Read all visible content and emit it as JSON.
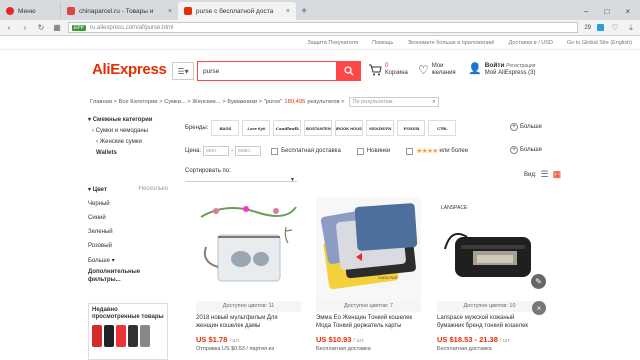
{
  "browser": {
    "menu_label": "Меню",
    "tabs": [
      {
        "label": "chinaparcel.ru - Товары и"
      },
      {
        "label": "purse с бесплатной доста"
      }
    ],
    "url_badge": "EPP",
    "url": "ru.aliexpress.com/af/purse.html",
    "zoom": "29"
  },
  "topnav": {
    "links": [
      "Защита Покупателя",
      "Помощь",
      "Экономьте больше в приложении!",
      "Доставка в",
      "/ USD",
      "Go to Global Site (English)"
    ]
  },
  "header": {
    "logo": "AliExpress",
    "search_value": "purse",
    "cart_count": "0",
    "cart_label": "Корзина",
    "wish_line1": "Мои",
    "wish_line2": "желания",
    "acct_line1": "Войти",
    "acct_line2": "Мой AliExpress",
    "acct_count": "(3)",
    "reg_label": "Регистрация"
  },
  "breadcrumb": {
    "trail": "Главная > Все Категории > Сумки... > Женские... > Бумажники > \"purse\"",
    "count": "180,495",
    "results_label": "результатов >",
    "search_placeholder": "По результатам"
  },
  "sidebar": {
    "related_title": "Смежные категории",
    "items": [
      "Сумки и чемоданы",
      "Женские сумки",
      "Wallets"
    ],
    "color_title": "Цвет",
    "color_more": "Несколько",
    "colors": [
      "Черный",
      "Синий",
      "Зеленый",
      "Розовый",
      "Больше"
    ],
    "extra_filters": "Дополнительные фильтры...",
    "promo_title": "Недавно просмотренные товары"
  },
  "filters": {
    "brands_label": "Бренды:",
    "brands": [
      "BAGS",
      "Love Kyli",
      "Candlewlk",
      "BOSTANTEN",
      "BROOK HOUSE",
      "SENDEFN",
      "FOXER",
      "CTRL"
    ],
    "more_label": "Больше",
    "price_label": "Цена:",
    "price_min": "мин.",
    "price_max": "макс.",
    "free_shipping": "Бесплатная доставка",
    "new_label": "Новинки",
    "rating_label": "или более",
    "more_label2": "Больше",
    "sort_label": "Сортировать по:",
    "view_label": "Вид:"
  },
  "products": [
    {
      "avail": "Доступно цветов: 11",
      "title": "2018 новый мультфильм Для женщин кошелек дамы",
      "price": "US $1.78",
      "unit": "/ шт.",
      "ship": "Отправка US $0.53 / партия из"
    },
    {
      "avail": "Доступно цветов: 7",
      "title": "Эмма Ео Женщин Тонкий кошелек Мода Тонкий держатель карты",
      "price": "US $10.93",
      "unit": "/ шт.",
      "ship": "Бесплатная доставка"
    },
    {
      "avail": "Доступно цветов: 10",
      "title": "Lanspace мужской кожаный бумажник бренд тонкий кошелек",
      "price": "US $18.53 - 21.38",
      "unit": "/ шт.",
      "ship": "Бесплатная доставка"
    }
  ],
  "product_tags": {
    "lanspace_text": "LANSPACE",
    "zara_text": "ZARA PAR"
  }
}
